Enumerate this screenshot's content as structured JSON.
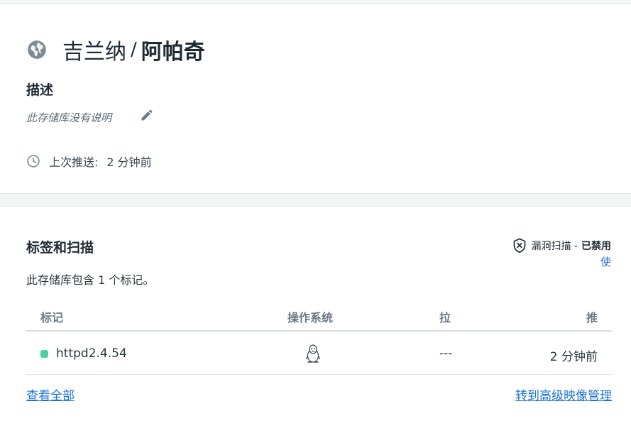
{
  "repo": {
    "namespace": "吉兰纳",
    "separator": "/",
    "name": "阿帕奇",
    "icon": "globe-icon"
  },
  "description": {
    "heading": "描述",
    "text": "此存储库没有说明",
    "edit_icon": "pencil-icon"
  },
  "last_pushed": {
    "label": "上次推送:",
    "value": "2 分钟前",
    "icon": "clock-icon"
  },
  "tags": {
    "heading": "标签和扫描",
    "summary": "此存储库包含 1 个标记。",
    "vulnerability": {
      "label": "漏洞扫描 -",
      "state": "已禁用",
      "link": "使",
      "icon": "shield-x-icon"
    },
    "columns": {
      "tag": "标记",
      "os": "操作系统",
      "pull": "拉",
      "push": "推"
    },
    "rows": [
      {
        "tag": "httpd2.4.54",
        "status_color": "#4cd1a0",
        "os_icon": "linux-icon",
        "pulled": "---",
        "pushed": "2 分钟前"
      }
    ],
    "view_all": "查看全部",
    "advanced": "转到高级映像管理"
  }
}
